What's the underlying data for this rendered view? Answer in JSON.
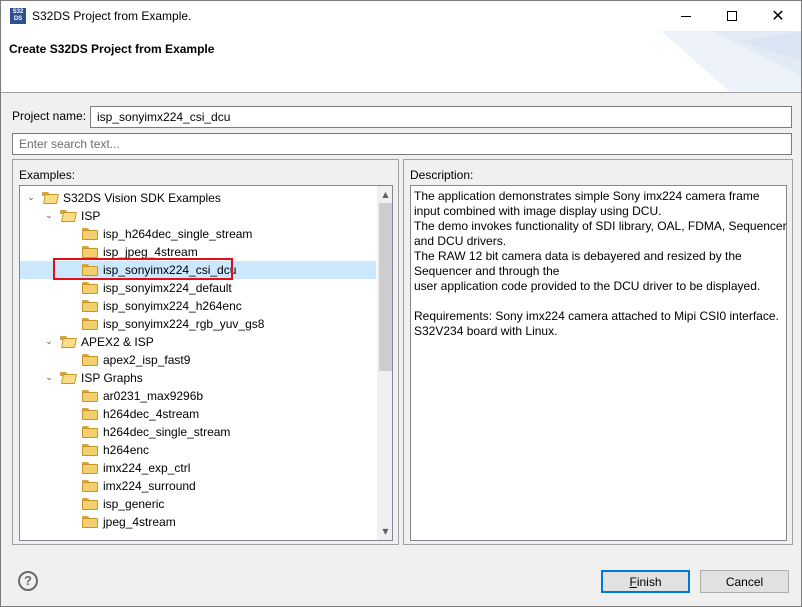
{
  "window": {
    "title": "S32DS Project from Example.",
    "icon_text": "S32 DS"
  },
  "header": {
    "title": "Create S32DS Project from Example"
  },
  "form": {
    "project_name_label": "Project name:",
    "project_name_value": "isp_sonyimx224_csi_dcu",
    "search_placeholder": "Enter search text..."
  },
  "examples": {
    "label": "Examples:",
    "tree": [
      {
        "label": "S32DS Vision SDK Examples",
        "level": 0,
        "type": "folder",
        "expanded": true
      },
      {
        "label": "ISP",
        "level": 1,
        "type": "folder",
        "expanded": true
      },
      {
        "label": "isp_h264dec_single_stream",
        "level": 2,
        "type": "project"
      },
      {
        "label": "isp_jpeg_4stream",
        "level": 2,
        "type": "project"
      },
      {
        "label": "isp_sonyimx224_csi_dcu",
        "level": 2,
        "type": "project",
        "selected": true
      },
      {
        "label": "isp_sonyimx224_default",
        "level": 2,
        "type": "project"
      },
      {
        "label": "isp_sonyimx224_h264enc",
        "level": 2,
        "type": "project"
      },
      {
        "label": "isp_sonyimx224_rgb_yuv_gs8",
        "level": 2,
        "type": "project"
      },
      {
        "label": "APEX2 & ISP",
        "level": 1,
        "type": "folder",
        "expanded": true
      },
      {
        "label": "apex2_isp_fast9",
        "level": 2,
        "type": "project"
      },
      {
        "label": "ISP Graphs",
        "level": 1,
        "type": "folder",
        "expanded": true
      },
      {
        "label": "ar0231_max9296b",
        "level": 2,
        "type": "project"
      },
      {
        "label": "h264dec_4stream",
        "level": 2,
        "type": "project"
      },
      {
        "label": "h264dec_single_stream",
        "level": 2,
        "type": "project"
      },
      {
        "label": "h264enc",
        "level": 2,
        "type": "project"
      },
      {
        "label": "imx224_exp_ctrl",
        "level": 2,
        "type": "project"
      },
      {
        "label": "imx224_surround",
        "level": 2,
        "type": "project"
      },
      {
        "label": "isp_generic",
        "level": 2,
        "type": "project"
      },
      {
        "label": "jpeg_4stream",
        "level": 2,
        "type": "project"
      }
    ]
  },
  "description": {
    "label": "Description:",
    "lines": [
      "The application demonstrates simple Sony imx224 camera frame",
      "input combined with image display using DCU.",
      "The demo invokes functionality of SDI library, OAL, FDMA, Sequencer",
      "and DCU drivers.",
      "The RAW 12 bit camera data is debayered and resized by the",
      "Sequencer and through the",
      "user application code provided to the DCU driver to be displayed.",
      "",
      "Requirements: Sony imx224 camera attached to Mipi CSI0 interface.",
      "S32V234 board with Linux."
    ]
  },
  "buttons": {
    "finish_first": "F",
    "finish_rest": "inish",
    "cancel": "Cancel",
    "help": "?"
  },
  "colors": {
    "selection": "#cce8ff",
    "highlight_border": "#e0101a",
    "default_button_border": "#0078d7"
  }
}
